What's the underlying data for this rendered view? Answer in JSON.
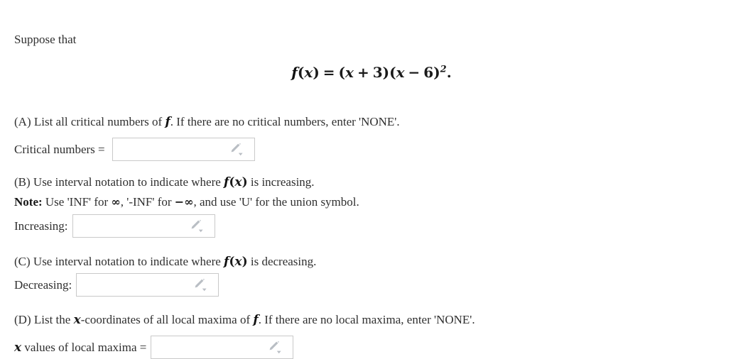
{
  "problem": {
    "intro": "Suppose that",
    "formula": {
      "lhs_f": "f",
      "lhs_arg": "x",
      "equals": "=",
      "factor1_var": "x",
      "factor1_op": "+",
      "factor1_num": "3",
      "factor2_var": "x",
      "factor2_op": "−",
      "factor2_num": "6",
      "exponent": "2",
      "period": ".",
      "plain": "f(x) = (x + 3)(x − 6)²."
    }
  },
  "parts": {
    "a": {
      "prompt_pre": "(A) List all critical numbers of ",
      "prompt_var": "f",
      "prompt_post": ". If there are no critical numbers, enter 'NONE'.",
      "label": "Critical numbers =",
      "value": "",
      "placeholder": ""
    },
    "b": {
      "prompt_pre": "(B) Use interval notation to indicate where ",
      "prompt_f": "f",
      "prompt_paren_open": "(",
      "prompt_x": "x",
      "prompt_paren_close": ")",
      "prompt_post": " is increasing.",
      "note_label": "Note:",
      "note_pre": " Use 'INF' for ",
      "note_inf1": "∞",
      "note_mid": ", '-INF' for ",
      "note_minus": "−",
      "note_inf2": "∞",
      "note_post": ", and use 'U' for the union symbol.",
      "label": "Increasing:",
      "value": "",
      "placeholder": ""
    },
    "c": {
      "prompt_pre": "(C) Use interval notation to indicate where ",
      "prompt_f": "f",
      "prompt_paren_open": "(",
      "prompt_x": "x",
      "prompt_paren_close": ")",
      "prompt_post": " is decreasing.",
      "label": "Decreasing:",
      "value": "",
      "placeholder": ""
    },
    "d": {
      "prompt_pre": "(D) List the ",
      "prompt_x": "x",
      "prompt_mid": "-coordinates of all local maxima of ",
      "prompt_f": "f",
      "prompt_post": ". If there are no local maxima, enter 'NONE'.",
      "label_x": "x",
      "label_rest": " values of local maxima =",
      "value": "",
      "placeholder": ""
    }
  },
  "icons": {
    "editor_pencil": "pencil-icon",
    "editor_chevron": "chevron-down-icon"
  },
  "colors": {
    "text": "#2f2f2f",
    "math": "#111111",
    "box_border": "#c9c9c9",
    "icon": "#b9bec4",
    "background": "#ffffff"
  }
}
